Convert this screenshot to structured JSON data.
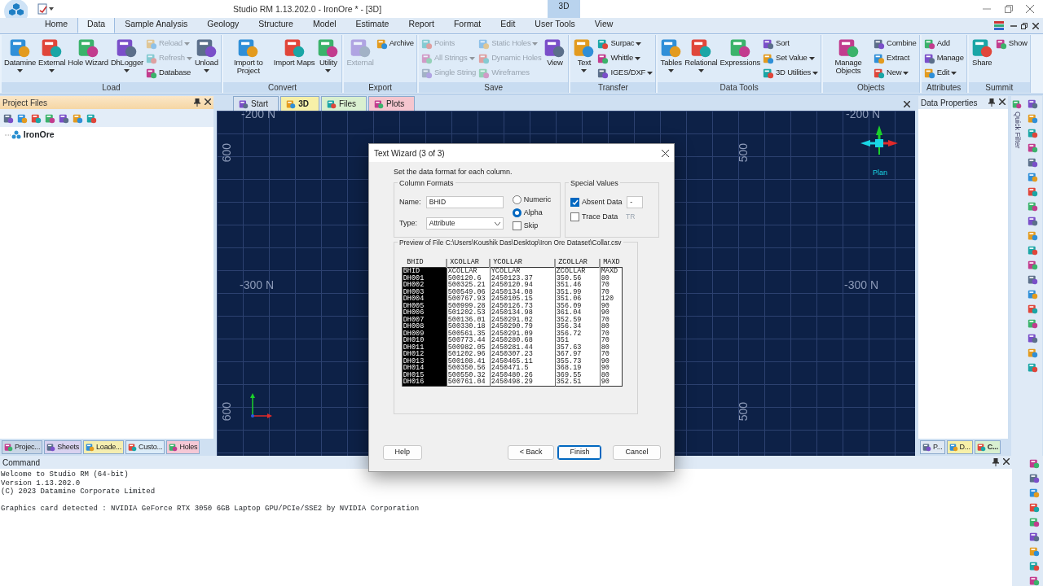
{
  "window": {
    "title": "Studio RM 1.13.202.0 - IronOre * - [3D]",
    "context_tab": "3D"
  },
  "ribbon_tabs": [
    {
      "label": "Home",
      "selected": false
    },
    {
      "label": "Data",
      "selected": true
    },
    {
      "label": "Sample Analysis",
      "selected": false
    },
    {
      "label": "Geology",
      "selected": false
    },
    {
      "label": "Structure",
      "selected": false
    },
    {
      "label": "Model",
      "selected": false
    },
    {
      "label": "Estimate",
      "selected": false
    },
    {
      "label": "Report",
      "selected": false
    },
    {
      "label": "Format",
      "selected": false
    },
    {
      "label": "Edit",
      "selected": false
    },
    {
      "label": "User Tools",
      "selected": false
    },
    {
      "label": "View",
      "selected": false
    }
  ],
  "ribbon_groups": [
    {
      "label": "Load",
      "items": [
        {
          "kind": "large",
          "label": "Datamine",
          "dropdown": true,
          "disabled": false
        },
        {
          "kind": "large",
          "label": "External",
          "dropdown": true,
          "disabled": false
        },
        {
          "kind": "large",
          "label": "Hole Wizard",
          "dropdown": false,
          "disabled": false
        },
        {
          "kind": "large",
          "label": "DhLogger",
          "dropdown": true,
          "disabled": false
        },
        {
          "kind": "stack",
          "items": [
            {
              "label": "Reload",
              "dropdown": true,
              "disabled": true
            },
            {
              "label": "Refresh",
              "dropdown": true,
              "disabled": true
            },
            {
              "label": "Database",
              "dropdown": false,
              "disabled": false
            }
          ]
        },
        {
          "kind": "large",
          "label": "Unload",
          "dropdown": true,
          "disabled": false
        }
      ]
    },
    {
      "label": "Convert",
      "items": [
        {
          "kind": "large",
          "label": "Import to Project",
          "dropdown": false,
          "disabled": false
        },
        {
          "kind": "large",
          "label": "Import Maps",
          "dropdown": false,
          "disabled": false
        },
        {
          "kind": "large",
          "label": "Utility",
          "dropdown": true,
          "disabled": false
        }
      ]
    },
    {
      "label": "Export",
      "items": [
        {
          "kind": "large",
          "label": "External",
          "dropdown": false,
          "disabled": true
        },
        {
          "kind": "stack",
          "items": [
            {
              "label": "Archive",
              "dropdown": false,
              "disabled": false
            }
          ]
        }
      ]
    },
    {
      "label": "Save",
      "items": [
        {
          "kind": "stack",
          "items": [
            {
              "label": "Points",
              "dropdown": false,
              "disabled": true
            },
            {
              "label": "All Strings",
              "dropdown": true,
              "disabled": true
            },
            {
              "label": "Single String",
              "dropdown": false,
              "disabled": true
            }
          ]
        },
        {
          "kind": "stack",
          "items": [
            {
              "label": "Static Holes",
              "dropdown": true,
              "disabled": true
            },
            {
              "label": "Dynamic Holes",
              "dropdown": false,
              "disabled": true
            },
            {
              "label": "Wireframes",
              "dropdown": false,
              "disabled": true
            }
          ]
        },
        {
          "kind": "large",
          "label": "View",
          "dropdown": false,
          "disabled": false
        }
      ]
    },
    {
      "label": "Transfer",
      "items": [
        {
          "kind": "large",
          "label": "Text",
          "dropdown": true,
          "disabled": false
        },
        {
          "kind": "stack",
          "items": [
            {
              "label": "Surpac",
              "dropdown": true,
              "disabled": false
            },
            {
              "label": "Whittle",
              "dropdown": true,
              "disabled": false
            },
            {
              "label": "IGES/DXF",
              "dropdown": true,
              "disabled": false
            }
          ]
        }
      ]
    },
    {
      "label": "Data Tools",
      "items": [
        {
          "kind": "large",
          "label": "Tables",
          "dropdown": true,
          "disabled": false
        },
        {
          "kind": "large",
          "label": "Relational",
          "dropdown": true,
          "disabled": false
        },
        {
          "kind": "large",
          "label": "Expressions",
          "dropdown": false,
          "disabled": false
        },
        {
          "kind": "stack",
          "items": [
            {
              "label": "Sort",
              "dropdown": false,
              "disabled": false
            },
            {
              "label": "Set Value",
              "dropdown": true,
              "disabled": false
            },
            {
              "label": "3D Utilities",
              "dropdown": true,
              "disabled": false
            }
          ]
        }
      ]
    },
    {
      "label": "Objects",
      "items": [
        {
          "kind": "large",
          "label": "Manage Objects",
          "dropdown": false,
          "disabled": false
        },
        {
          "kind": "stack",
          "items": [
            {
              "label": "Combine",
              "dropdown": false,
              "disabled": false
            },
            {
              "label": "Extract",
              "dropdown": false,
              "disabled": false
            },
            {
              "label": "New",
              "dropdown": true,
              "disabled": false
            }
          ]
        }
      ]
    },
    {
      "label": "Attributes",
      "items": [
        {
          "kind": "stack",
          "items": [
            {
              "label": "Add",
              "dropdown": false,
              "disabled": false
            },
            {
              "label": "Manage",
              "dropdown": false,
              "disabled": false
            },
            {
              "label": "Edit",
              "dropdown": true,
              "disabled": false
            }
          ]
        }
      ]
    },
    {
      "label": "Summit",
      "items": [
        {
          "kind": "large",
          "label": "Share",
          "dropdown": false,
          "disabled": false
        },
        {
          "kind": "stack",
          "items": [
            {
              "label": "Show",
              "dropdown": false,
              "disabled": false
            }
          ]
        }
      ]
    }
  ],
  "project_panel": {
    "title": "Project Files",
    "tree": [
      {
        "label": "IronOre"
      }
    ],
    "bottom_tabs": [
      {
        "label": "Projec...",
        "color": "#c9d6e6",
        "selected": false
      },
      {
        "label": "Sheets",
        "color": "#d9d2f0",
        "selected": false
      },
      {
        "label": "Loade...",
        "color": "#f5eeb0",
        "selected": false
      },
      {
        "label": "Custo...",
        "color": "#dcecf8",
        "selected": false
      },
      {
        "label": "Holes",
        "color": "#f5c8d6",
        "selected": false
      }
    ]
  },
  "view_tabs": [
    {
      "label": "Start",
      "color": "#d7e3f0",
      "selected": false
    },
    {
      "label": "3D",
      "color": "#f7f0a8",
      "selected": true
    },
    {
      "label": "Files",
      "color": "#d9f0d0",
      "selected": false
    },
    {
      "label": "Plots",
      "color": "#f5c6cf",
      "selected": false
    }
  ],
  "viewport": {
    "labels": [
      {
        "text": "-200 N",
        "kind": "north"
      },
      {
        "text": "-200 N",
        "kind": "north"
      },
      {
        "text": "-300 N",
        "kind": "north"
      },
      {
        "text": "-300 N",
        "kind": "north"
      },
      {
        "text": "600",
        "kind": "east"
      },
      {
        "text": "600",
        "kind": "east"
      },
      {
        "text": "500",
        "kind": "east"
      },
      {
        "text": "500",
        "kind": "east"
      }
    ],
    "compass_label": "Plan"
  },
  "properties_panel": {
    "title": "Data Properties",
    "side_label": "Quick Filter",
    "bottom_tabs": [
      {
        "label": "P...",
        "color": "#dfe8f3",
        "selected": false
      },
      {
        "label": "D...",
        "color": "#f7f0a8",
        "selected": false
      },
      {
        "label": "C...",
        "color": "#d9f0d0",
        "selected": true
      }
    ]
  },
  "command": {
    "title": "Command",
    "paragraphs": [
      [
        "Welcome to Studio RM (64-bit)",
        "Version 1.13.202.0",
        "(C) 2023 Datamine Corporate Limited"
      ],
      [
        "Graphics card detected : NVIDIA GeForce RTX 3050 6GB Laptop GPU/PCIe/SSE2 by NVIDIA Corporation"
      ]
    ]
  },
  "dialog": {
    "title": "Text Wizard (3 of 3)",
    "instruction": "Set the data format for each column.",
    "column_formats": {
      "title": "Column Formats",
      "name_label": "Name:",
      "name_value": "BHID",
      "type_label": "Type:",
      "type_value": "Attribute",
      "options": [
        {
          "kind": "radio",
          "label": "Numeric",
          "selected": false
        },
        {
          "kind": "radio",
          "label": "Alpha",
          "selected": true
        },
        {
          "kind": "checkbox",
          "label": "Skip",
          "checked": false
        }
      ]
    },
    "special_values": {
      "title": "Special Values",
      "items": [
        {
          "label": "Absent Data",
          "checked": true,
          "value": "-"
        },
        {
          "label": "Trace Data",
          "checked": false,
          "value": "TR"
        }
      ]
    },
    "preview_label": "Preview of File C:\\Users\\Koushik Das\\Desktop\\Iron Ore Dataset\\Collar.csv",
    "preview": {
      "columns": [
        {
          "label": "BHID",
          "selected": true
        },
        {
          "label": "XCOLLAR",
          "selected": false
        },
        {
          "label": "YCOLLAR",
          "selected": false
        },
        {
          "label": "ZCOLLAR",
          "selected": false
        },
        {
          "label": "MAXD",
          "selected": false
        }
      ],
      "rows": [
        [
          "BHID",
          "XCOLLAR",
          "YCOLLAR",
          "ZCOLLAR",
          "MAXD"
        ],
        [
          "DH001",
          "500120.6",
          "2450123.37",
          "350.56",
          "80"
        ],
        [
          "DH002",
          "500325.21",
          "2450120.94",
          "351.46",
          "70"
        ],
        [
          "DH003",
          "500549.06",
          "2450134.08",
          "351.99",
          "70"
        ],
        [
          "DH004",
          "500767.93",
          "2450105.15",
          "351.06",
          "120"
        ],
        [
          "DH005",
          "500999.28",
          "2450126.73",
          "356.09",
          "90"
        ],
        [
          "DH006",
          "501202.53",
          "2450134.98",
          "361.04",
          "90"
        ],
        [
          "DH007",
          "500136.01",
          "2450291.02",
          "352.59",
          "70"
        ],
        [
          "DH008",
          "500330.18",
          "2450290.79",
          "356.34",
          "80"
        ],
        [
          "DH009",
          "500561.35",
          "2450291.09",
          "356.72",
          "70"
        ],
        [
          "DH010",
          "500773.44",
          "2450280.68",
          "351",
          "70"
        ],
        [
          "DH011",
          "500982.05",
          "2450281.44",
          "357.63",
          "80"
        ],
        [
          "DH012",
          "501202.96",
          "2450307.23",
          "367.97",
          "70"
        ],
        [
          "DH013",
          "500108.41",
          "2450465.11",
          "355.73",
          "90"
        ],
        [
          "DH014",
          "500350.56",
          "2450471.5",
          "368.19",
          "90"
        ],
        [
          "DH015",
          "500550.32",
          "2450480.26",
          "369.55",
          "80"
        ],
        [
          "DH016",
          "500761.04",
          "2450498.29",
          "352.51",
          "90"
        ]
      ]
    },
    "buttons": [
      {
        "label": "Help",
        "kind": "help",
        "default": false
      },
      {
        "label": "< Back",
        "kind": "nav",
        "default": false
      },
      {
        "label": "Finish",
        "kind": "nav",
        "default": true
      },
      {
        "label": "Cancel",
        "kind": "cancel",
        "default": false
      }
    ]
  }
}
